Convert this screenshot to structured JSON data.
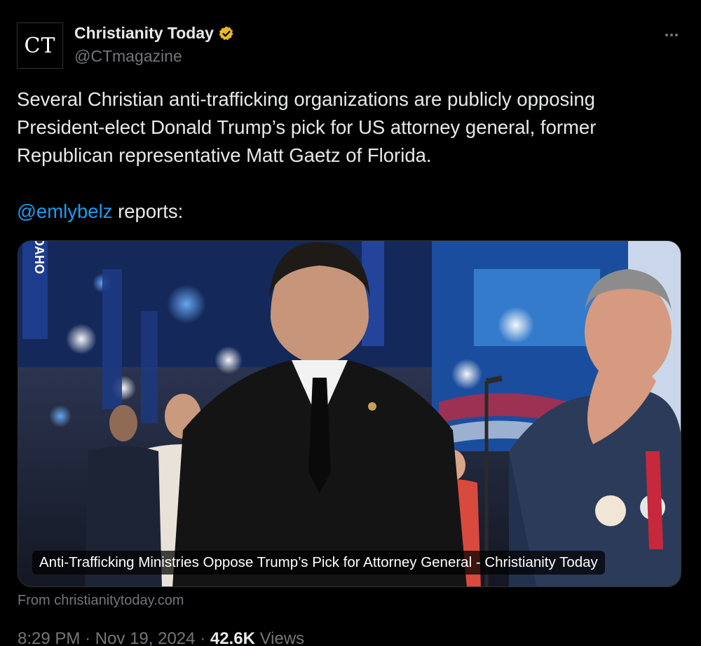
{
  "author": {
    "avatar_text": "CT",
    "display_name": "Christianity Today",
    "handle": "@CTmagazine",
    "verified_icon": "gold-verified-badge-icon",
    "verified_color": "#e8b829"
  },
  "more_icon": "more-horizontal-icon",
  "tweet": {
    "lines": [
      "Several Christian anti-trafficking organizations are publicly opposing",
      "President-elect Donald Trump’s pick for US attorney general, former",
      "Republican representative Matt Gaetz of Florida."
    ],
    "mention": "@emlybelz",
    "mention_suffix": " reports:"
  },
  "card": {
    "caption": "Anti-Trafficking Ministries Oppose Trump’s Pick for Attorney General - Christianity Today",
    "banner_text": "IDAHO",
    "from": "From christianitytoday.com"
  },
  "meta": {
    "time": "8:29 PM",
    "date": "Nov 19, 2024",
    "views_count": "42.6K",
    "views_label": "Views",
    "separator": "·"
  },
  "colors": {
    "background": "#000000",
    "text": "#e7e9ea",
    "secondary": "#71767b",
    "link": "#1d9bf0"
  }
}
